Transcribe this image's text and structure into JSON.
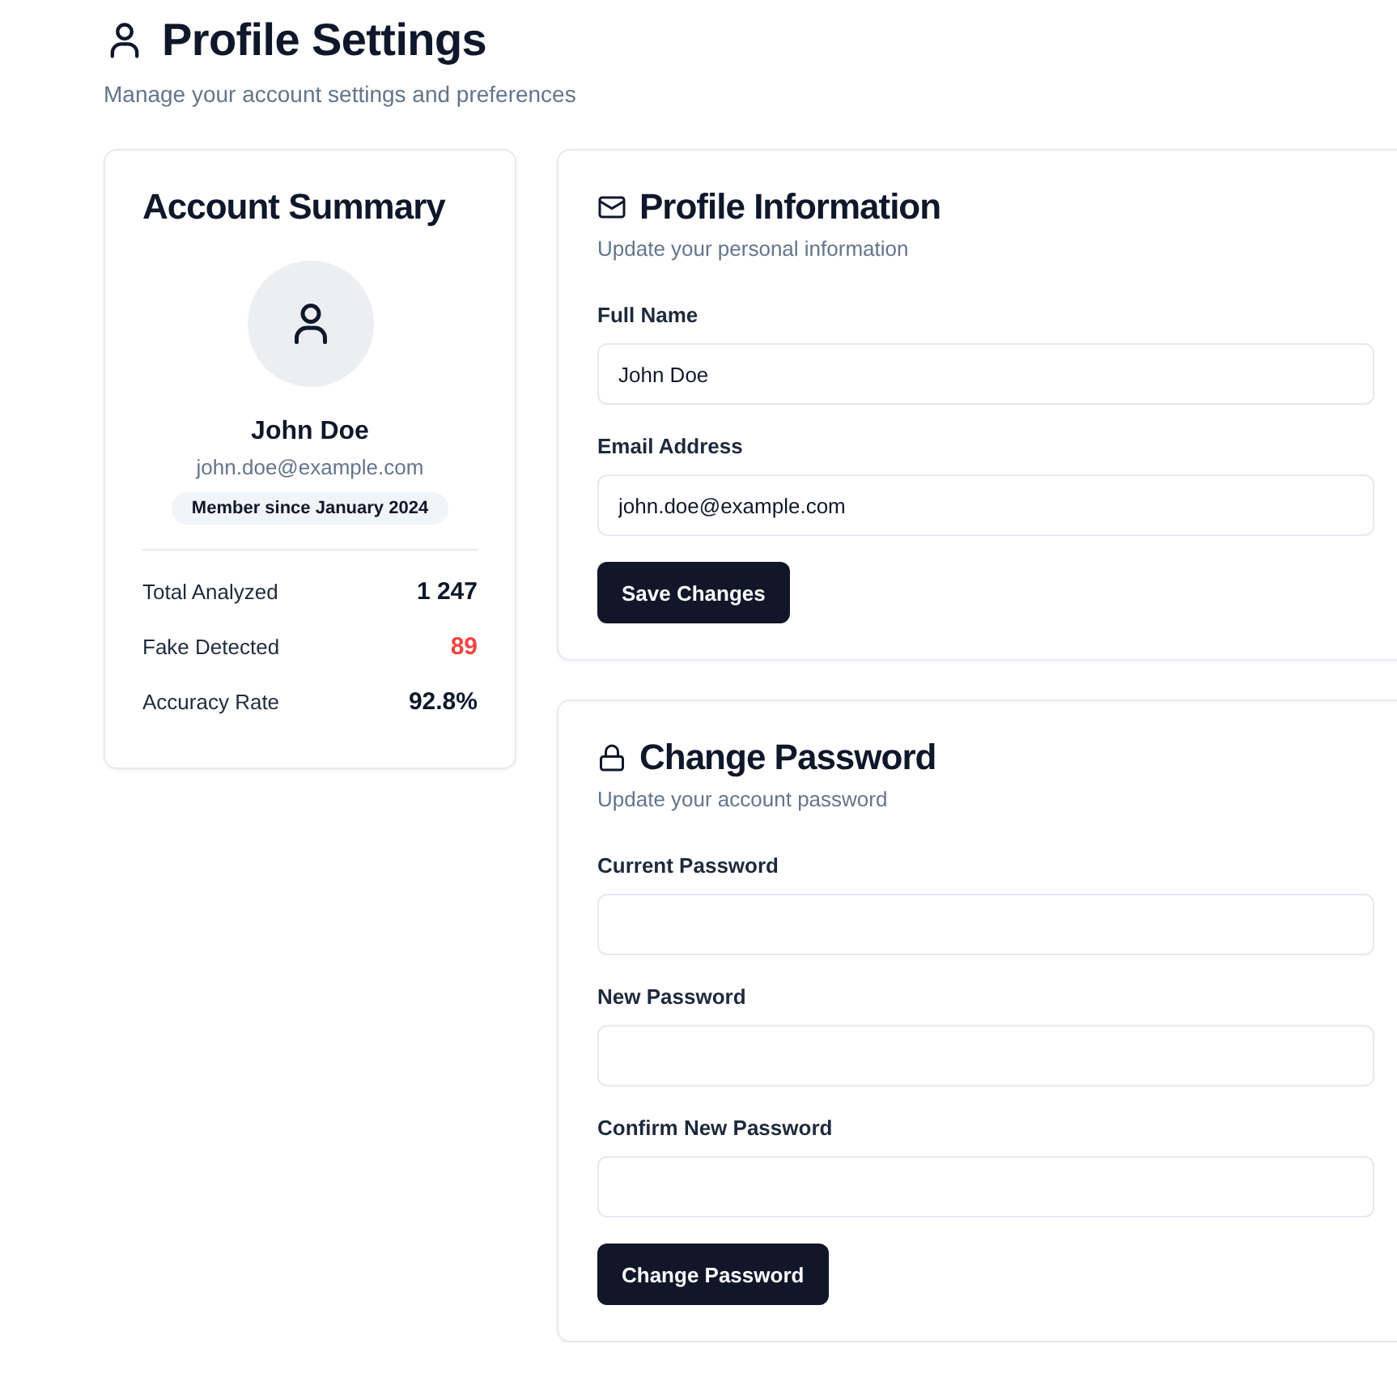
{
  "header": {
    "title": "Profile Settings",
    "subtitle": "Manage your account settings and preferences"
  },
  "summary": {
    "title": "Account Summary",
    "name": "John Doe",
    "email": "john.doe@example.com",
    "badge": "Member since January 2024",
    "stats": [
      {
        "label": "Total Analyzed",
        "value": "1 247",
        "color": "#0f172a"
      },
      {
        "label": "Fake Detected",
        "value": "89",
        "color": "#ef4444"
      },
      {
        "label": "Accuracy Rate",
        "value": "92.8%",
        "color": "#0f172a"
      }
    ]
  },
  "sections": [
    {
      "kind": "mail",
      "title": "Profile Information",
      "subtitle": "Update your personal information",
      "fields": [
        {
          "label": "Full Name",
          "value": "John Doe"
        },
        {
          "label": "Email Address",
          "value": "john.doe@example.com"
        }
      ],
      "button": "Save Changes"
    },
    {
      "kind": "lock",
      "title": "Change Password",
      "subtitle": "Update your account password",
      "fields": [
        {
          "label": "Current Password"
        },
        {
          "label": "New Password"
        },
        {
          "label": "Confirm New Password"
        }
      ],
      "button": "Change Password"
    }
  ]
}
